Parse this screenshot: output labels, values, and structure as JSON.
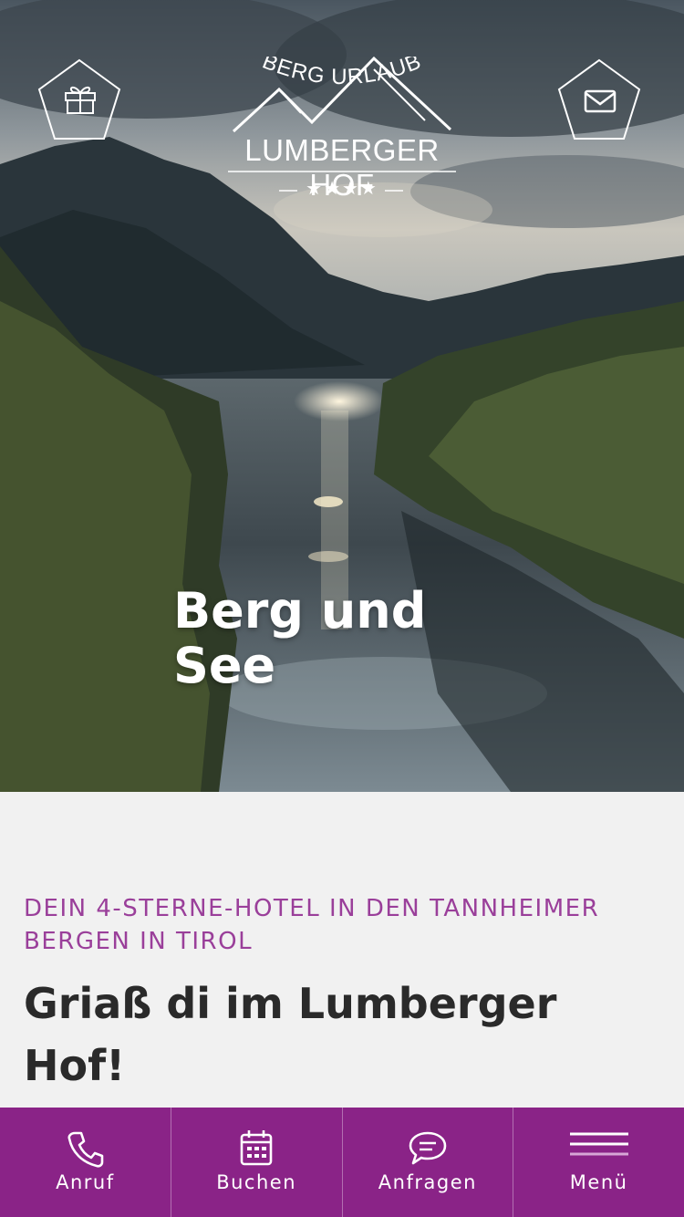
{
  "header": {
    "left_icon": "gift-icon",
    "right_icon": "envelope-icon",
    "logo": {
      "name": "LUMBERGER HOF",
      "stars": "★★★★",
      "tagline": "BERG URLAUB"
    }
  },
  "hero": {
    "title_line1": "Berg und",
    "title_line2": "See"
  },
  "intro": {
    "kicker": "DEIN 4-STERNE-HOTEL IN DEN TANNHEIMER BERGEN IN TIROL",
    "headline": "Griaß di im Lumberger Hof!"
  },
  "bottom_nav": {
    "items": [
      {
        "label": "Anruf",
        "icon": "phone-icon"
      },
      {
        "label": "Buchen",
        "icon": "calendar-icon"
      },
      {
        "label": "Anfragen",
        "icon": "chat-icon"
      },
      {
        "label": "Menü",
        "icon": "menu-icon"
      }
    ]
  },
  "colors": {
    "brand_purple": "#8a2387",
    "kicker_purple": "#9a3f9a",
    "headline": "#2a2a2a",
    "background": "#f1f1f1"
  }
}
